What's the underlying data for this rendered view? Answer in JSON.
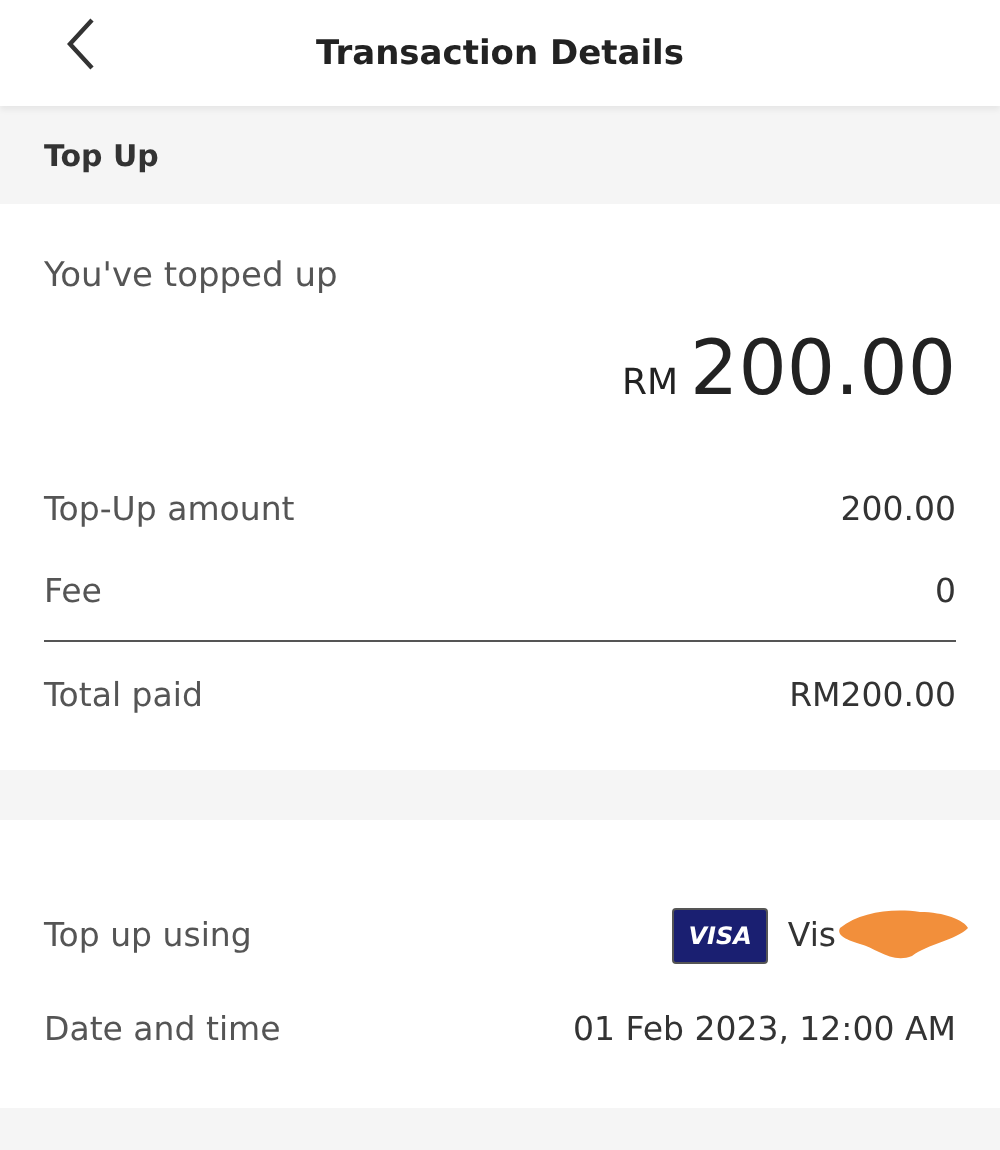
{
  "header": {
    "title": "Transaction Details"
  },
  "section_label": "Top Up",
  "summary": {
    "caption": "You've topped up",
    "currency": "RM",
    "amount": "200.00"
  },
  "breakdown": [
    {
      "label": "Top-Up amount",
      "value": "200.00"
    },
    {
      "label": "Fee",
      "value": "0"
    }
  ],
  "total": {
    "label": "Total paid",
    "value": "RM200.00"
  },
  "details": [
    {
      "kind": "card",
      "label": "Top up using",
      "badge": "VISA",
      "value": "Vis"
    },
    {
      "kind": "text",
      "label": "Date and time",
      "value": "01 Feb 2023, 12:00 AM"
    }
  ]
}
